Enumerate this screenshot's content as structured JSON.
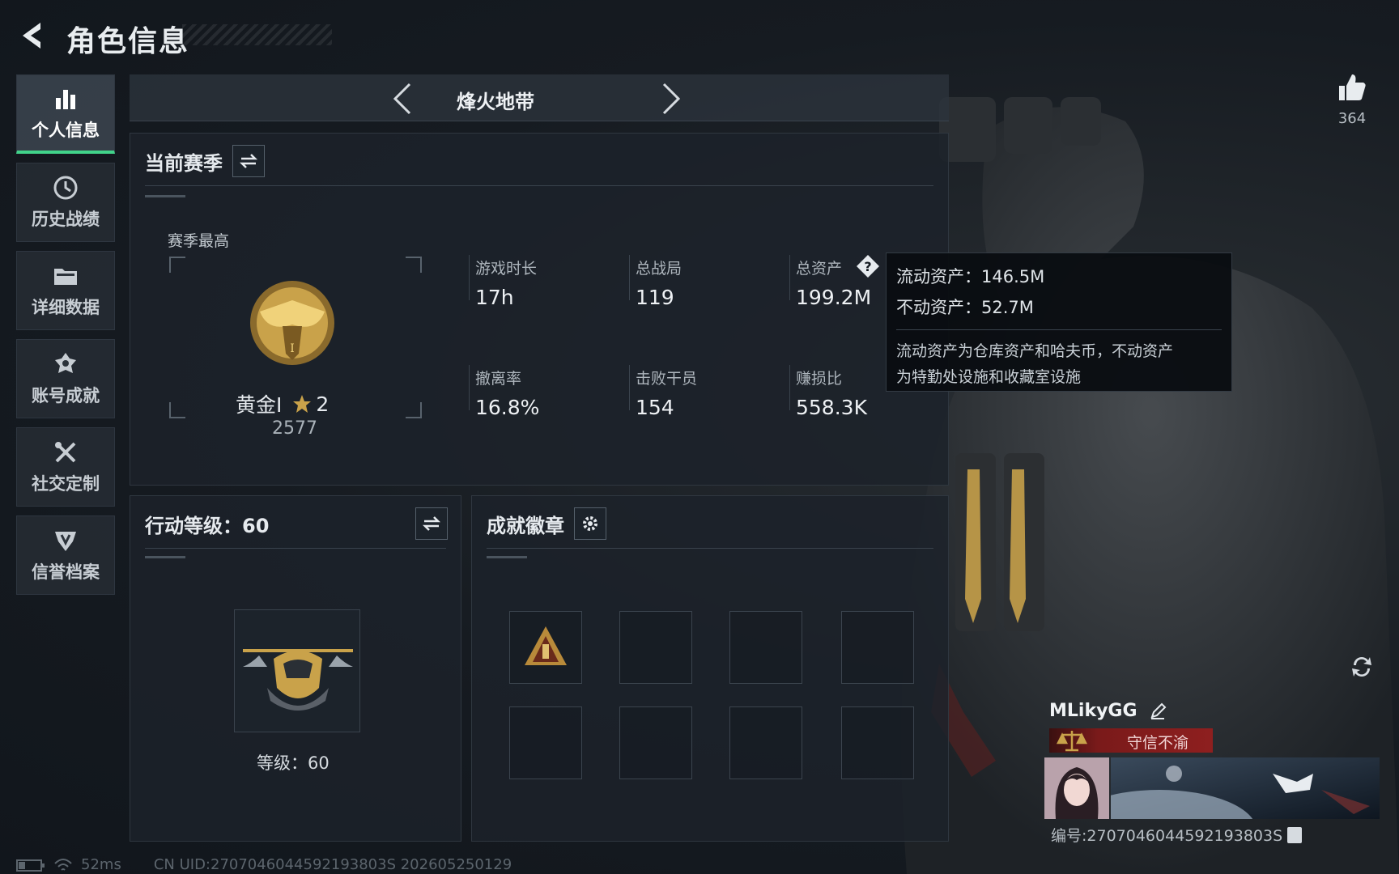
{
  "header": {
    "title": "角色信息"
  },
  "like": {
    "count": "364"
  },
  "sidebar": {
    "items": [
      {
        "label": "个人信息",
        "icon": "bar-chart-icon",
        "active": true
      },
      {
        "label": "历史战绩",
        "icon": "history-icon",
        "active": false
      },
      {
        "label": "详细数据",
        "icon": "folder-icon",
        "active": false
      },
      {
        "label": "账号成就",
        "icon": "achievement-icon",
        "active": false
      },
      {
        "label": "社交定制",
        "icon": "tools-icon",
        "active": false
      },
      {
        "label": "信誉档案",
        "icon": "credit-shield-icon",
        "active": false
      }
    ]
  },
  "mode": {
    "label": "烽火地带"
  },
  "season": {
    "title": "当前赛季",
    "best_label": "赛季最高",
    "rank_name": "黄金I",
    "rank_stars": "2",
    "rank_score": "2577",
    "stats": [
      {
        "label": "游戏时长",
        "value": "17h"
      },
      {
        "label": "总战局",
        "value": "119"
      },
      {
        "label": "总资产",
        "value": "199.2M"
      },
      {
        "label": "撤离率",
        "value": "16.8%"
      },
      {
        "label": "击败干员",
        "value": "154"
      },
      {
        "label": "赚损比",
        "value": "558.3K"
      }
    ]
  },
  "tooltip": {
    "liquid": "流动资产：146.5M",
    "fixed": "不动资产：52.7M",
    "desc_line1": "流动资产为仓库资产和哈夫币，不动资产",
    "desc_line2": "为特勤处设施和收藏室设施"
  },
  "action_level": {
    "title": "行动等级：60",
    "level_text": "等级：60"
  },
  "achievements": {
    "title": "成就徽章"
  },
  "player": {
    "name": "MLikyGG",
    "credit_title": "守信不渝",
    "id_text": "编号:2707046044592193803S"
  },
  "footer": {
    "ping": "52ms",
    "uid": "CN UID:2707046044592193803S 202605250129"
  },
  "colors": {
    "accent_green": "#41d38a",
    "credit_red": "#8e1f1f",
    "gold": "#c9a24a"
  }
}
